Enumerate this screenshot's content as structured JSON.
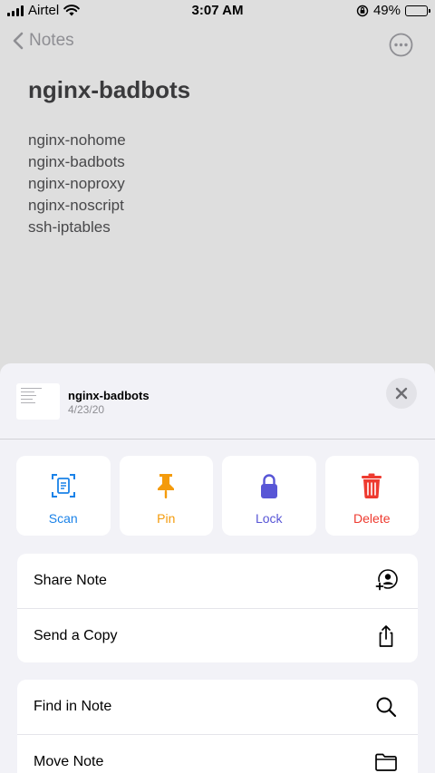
{
  "status_bar": {
    "carrier": "Airtel",
    "time": "3:07 AM",
    "battery_percent": "49%",
    "battery_level": 0.49
  },
  "nav": {
    "back_label": "Notes"
  },
  "note": {
    "title": "nginx-badbots",
    "lines": [
      "nginx-nohome",
      "nginx-badbots",
      "nginx-noproxy",
      "nginx-noscript",
      "ssh-iptables"
    ]
  },
  "sheet": {
    "title": "nginx-badbots",
    "date": "4/23/20",
    "actions": [
      {
        "label": "Scan",
        "color": "#1a82e8",
        "icon": "scan-icon"
      },
      {
        "label": "Pin",
        "color": "#f49b0b",
        "icon": "pin-icon"
      },
      {
        "label": "Lock",
        "color": "#5856d6",
        "icon": "lock-icon"
      },
      {
        "label": "Delete",
        "color": "#ee3a2f",
        "icon": "trash-icon"
      }
    ],
    "group1": [
      {
        "label": "Share Note",
        "icon": "share-person-icon"
      },
      {
        "label": "Send a Copy",
        "icon": "share-arrow-icon"
      }
    ],
    "group2": [
      {
        "label": "Find in Note",
        "icon": "magnifier-icon"
      },
      {
        "label": "Move Note",
        "icon": "folder-icon"
      }
    ]
  }
}
